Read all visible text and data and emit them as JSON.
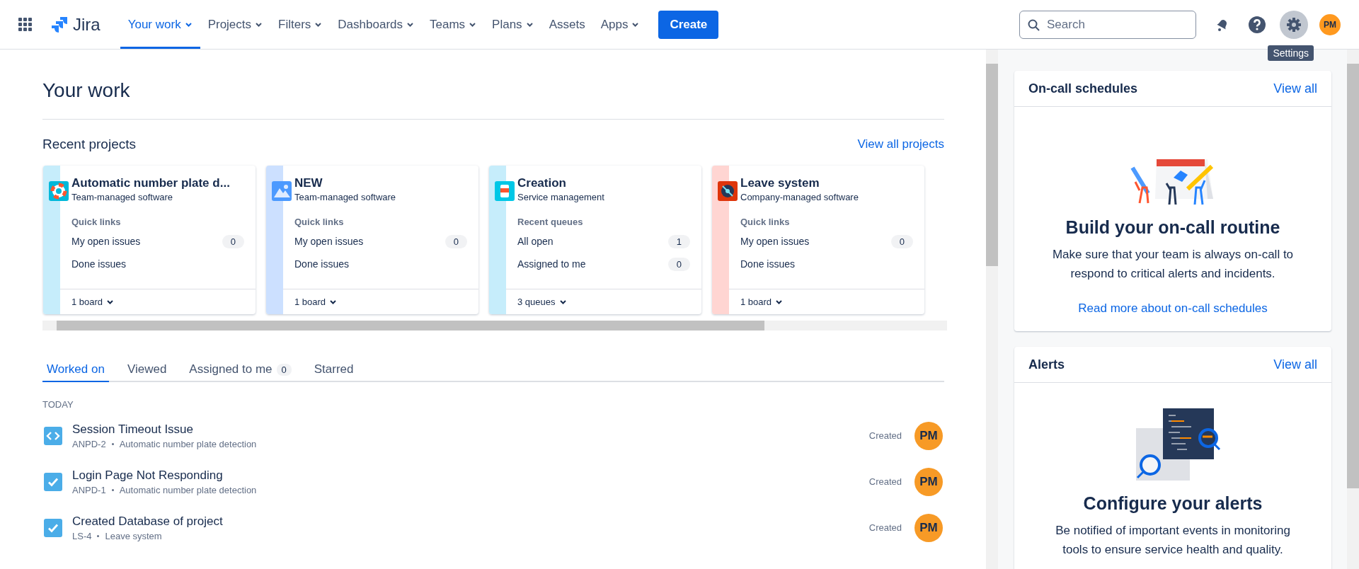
{
  "nav": {
    "app_name": "Jira",
    "items": [
      {
        "label": "Your work",
        "selected": true,
        "dropdown": true
      },
      {
        "label": "Projects",
        "selected": false,
        "dropdown": true
      },
      {
        "label": "Filters",
        "selected": false,
        "dropdown": true
      },
      {
        "label": "Dashboards",
        "selected": false,
        "dropdown": true
      },
      {
        "label": "Teams",
        "selected": false,
        "dropdown": true
      },
      {
        "label": "Plans",
        "selected": false,
        "dropdown": true
      },
      {
        "label": "Assets",
        "selected": false,
        "dropdown": false
      },
      {
        "label": "Apps",
        "selected": false,
        "dropdown": true
      }
    ],
    "create": "Create",
    "search": {
      "placeholder": "Search"
    },
    "avatar": "PM",
    "tooltip": "Settings"
  },
  "page_title": "Your work",
  "recent_projects": {
    "title": "Recent projects",
    "view_all": "View all projects",
    "projects": [
      {
        "name": "Automatic number plate d...",
        "type": "Team-managed software",
        "kind": "lifebuoy",
        "color": "#c6edfb",
        "section": "Quick links",
        "links": [
          {
            "label": "My open issues",
            "count": "0"
          },
          {
            "label": "Done issues"
          }
        ],
        "footer": "1 board"
      },
      {
        "name": "NEW",
        "type": "Team-managed software",
        "kind": "mountains",
        "color": "#cce0ff",
        "section": "Quick links",
        "links": [
          {
            "label": "My open issues",
            "count": "0"
          },
          {
            "label": "Done issues"
          }
        ],
        "footer": "1 board"
      },
      {
        "name": "Creation",
        "type": "Service management",
        "kind": "cup",
        "color": "#c6edfb",
        "section": "Recent queues",
        "links": [
          {
            "label": "All open",
            "count": "1"
          },
          {
            "label": "Assigned to me",
            "count": "0"
          }
        ],
        "footer": "3 queues"
      },
      {
        "name": "Leave system",
        "type": "Company-managed software",
        "kind": "disc",
        "color": "#ffd5d2",
        "section": "Quick links",
        "links": [
          {
            "label": "My open issues",
            "count": "0"
          },
          {
            "label": "Done issues"
          }
        ],
        "footer": "1 board"
      }
    ]
  },
  "tabs": [
    {
      "label": "Worked on",
      "selected": true
    },
    {
      "label": "Viewed",
      "selected": false
    },
    {
      "label": "Assigned to me",
      "selected": false,
      "count": "0"
    },
    {
      "label": "Starred",
      "selected": false
    }
  ],
  "group": "TODAY",
  "items": [
    {
      "kind": "code",
      "title": "Session Timeout Issue",
      "key": "ANPD-2",
      "project": "Automatic number plate detection",
      "action": "Created",
      "avatar": "PM"
    },
    {
      "kind": "check",
      "title": "Login Page Not Responding",
      "key": "ANPD-1",
      "project": "Automatic number plate detection",
      "action": "Created",
      "avatar": "PM"
    },
    {
      "kind": "check",
      "title": "Created Database of project",
      "key": "LS-4",
      "project": "Leave system",
      "action": "Created",
      "avatar": "PM"
    }
  ],
  "side_cards": [
    {
      "kind": "schedule",
      "title": "On-call schedules",
      "view_all": "View all",
      "heading": "Build your on-call routine",
      "body": "Make sure that your team is always on-call to respond to critical alerts and incidents.",
      "link": "Read more about on-call schedules"
    },
    {
      "kind": "alerts",
      "title": "Alerts",
      "view_all": "View all",
      "heading": "Configure your alerts",
      "body": "Be notified of important events in monitoring tools to ensure service health and quality."
    }
  ]
}
